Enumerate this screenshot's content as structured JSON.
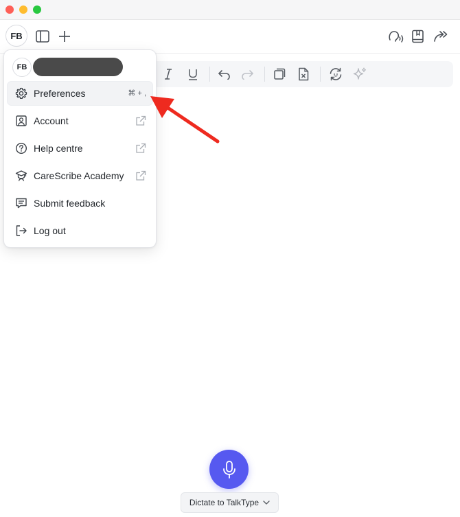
{
  "window": {
    "controls": [
      "close",
      "minimize",
      "maximize"
    ]
  },
  "topbar": {
    "avatar_initials": "FB",
    "left_icons": [
      "sidebar-toggle-icon",
      "plus-icon"
    ],
    "right_icons": [
      "listening-icon",
      "book-icon",
      "forward-share-icon"
    ]
  },
  "editor_toolbar": {
    "icons": [
      "italic-icon",
      "underline-icon",
      "undo-icon",
      "redo-icon",
      "copy-icon",
      "clear-document-icon",
      "regenerate-icon",
      "sparkles-icon"
    ]
  },
  "account_menu": {
    "avatar_initials": "FB",
    "items": [
      {
        "label": "Preferences",
        "icon": "gear-icon",
        "shortcut": "⌘ + ,",
        "external": false
      },
      {
        "label": "Account",
        "icon": "account-icon",
        "external": true
      },
      {
        "label": "Help centre",
        "icon": "help-icon",
        "external": true
      },
      {
        "label": "CareScribe Academy",
        "icon": "graduation-icon",
        "external": true
      },
      {
        "label": "Submit feedback",
        "icon": "feedback-icon",
        "external": false
      },
      {
        "label": "Log out",
        "icon": "logout-icon",
        "external": false
      }
    ]
  },
  "dictation": {
    "button_label": "Dictate to TalkType"
  },
  "colors": {
    "accent": "#5659f0",
    "annotation_arrow": "#ee2a1f"
  }
}
